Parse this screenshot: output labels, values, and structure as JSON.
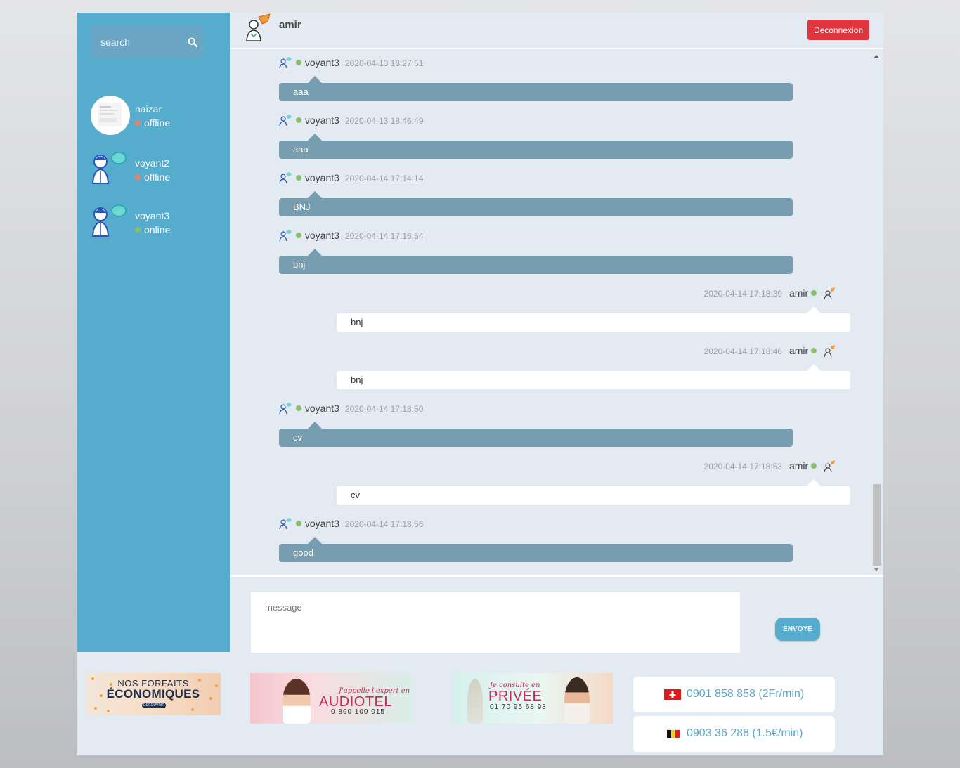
{
  "search": {
    "placeholder": "search"
  },
  "contacts": [
    {
      "name": "naizar",
      "status": "offline",
      "status_color": "#e8806a"
    },
    {
      "name": "voyant2",
      "status": "offline",
      "status_color": "#e8806a"
    },
    {
      "name": "voyant3",
      "status": "online",
      "status_color": "#86c06a"
    }
  ],
  "header": {
    "username": "amir",
    "logout_label": "Deconnexion"
  },
  "messages": [
    {
      "direction": "in",
      "sender": "voyant3",
      "time": "2020-04-13 18:27:51",
      "text": "aaa"
    },
    {
      "direction": "in",
      "sender": "voyant3",
      "time": "2020-04-13 18:46:49",
      "text": "aaa"
    },
    {
      "direction": "in",
      "sender": "voyant3",
      "time": "2020-04-14 17:14:14",
      "text": "BNJ"
    },
    {
      "direction": "in",
      "sender": "voyant3",
      "time": "2020-04-14 17:16:54",
      "text": "bnj"
    },
    {
      "direction": "out",
      "sender": "amir",
      "time": "2020-04-14 17:18:39",
      "text": "bnj"
    },
    {
      "direction": "out",
      "sender": "amir",
      "time": "2020-04-14 17:18:46",
      "text": "bnj"
    },
    {
      "direction": "in",
      "sender": "voyant3",
      "time": "2020-04-14 17:18:50",
      "text": "cv"
    },
    {
      "direction": "out",
      "sender": "amir",
      "time": "2020-04-14 17:18:53",
      "text": "cv"
    },
    {
      "direction": "in",
      "sender": "voyant3",
      "time": "2020-04-14 17:18:56",
      "text": "good"
    }
  ],
  "composer": {
    "placeholder": "message",
    "send_label": "ENVOYE"
  },
  "banners": {
    "forfaits": {
      "line1": "NOS FORFAITS",
      "line2": "ÉCONOMIQUES",
      "cta": "DÉCOUVRIR"
    },
    "audiotel": {
      "script": "J'appelle l'expert en",
      "big": "AUDIOTEL",
      "number": "0 890 100 015"
    },
    "privee": {
      "script": "Je consulte en",
      "big": "PRIVÉE",
      "number": "01 70 95 68 98"
    }
  },
  "phones": [
    {
      "country": "Switzerland",
      "text": "0901 858 858 (2Fr/min)"
    },
    {
      "country": "Belgium",
      "text": "0903 36 288 (1.5€/min)"
    }
  ],
  "colors": {
    "sidebar": "#56accd",
    "incoming_bubble": "#779eb0",
    "logout": "#e0363f",
    "online": "#86c06a",
    "offline": "#e8806a"
  }
}
